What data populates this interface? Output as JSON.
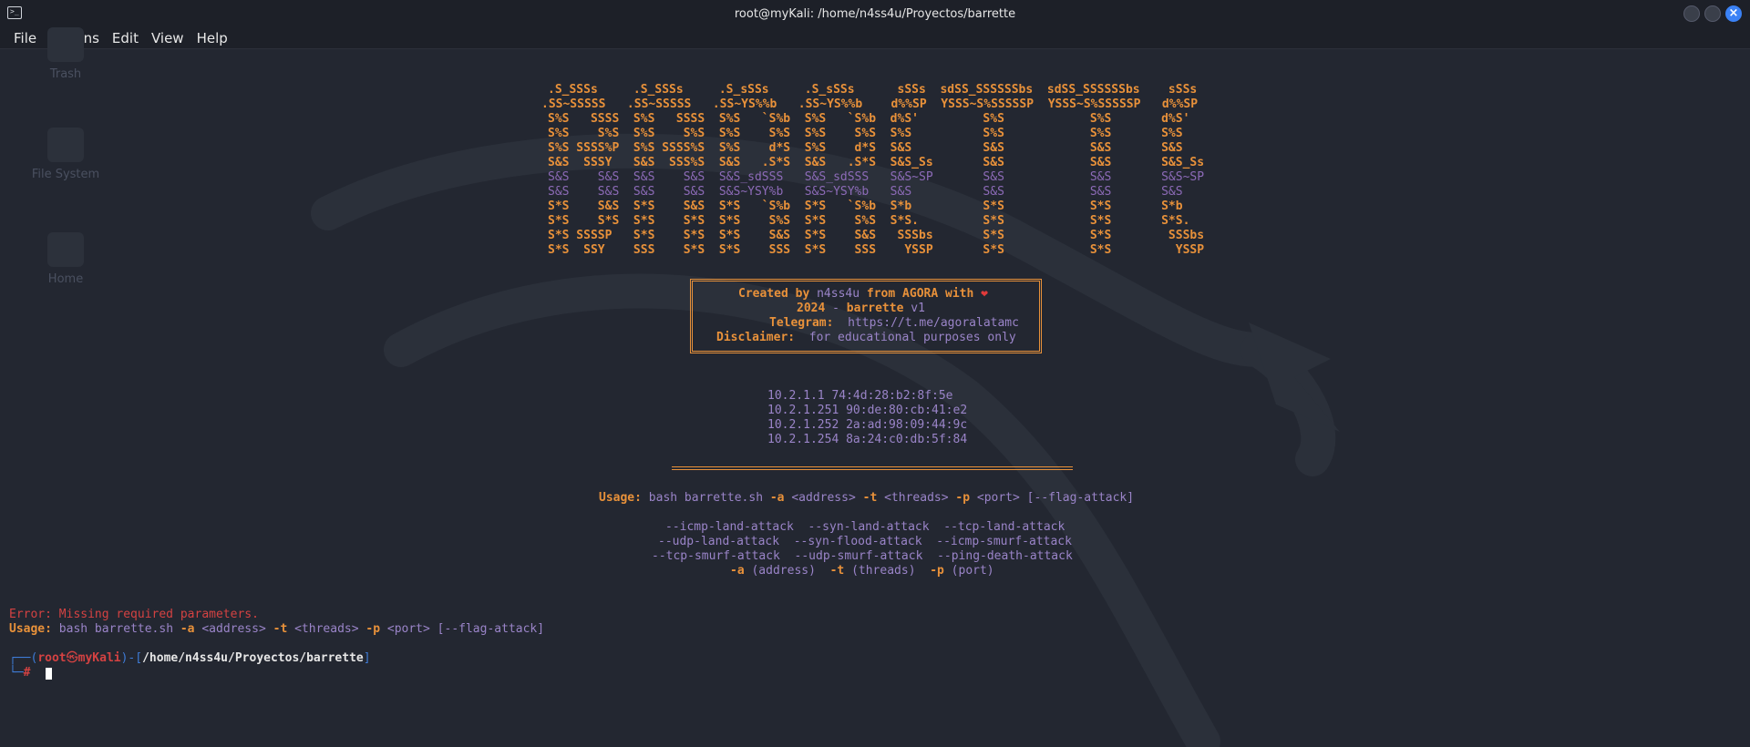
{
  "window": {
    "title": "root@myKali: /home/n4ss4u/Proyectos/barrette",
    "close_glyph": "×"
  },
  "menu": {
    "file": "File",
    "actions": "Actions",
    "edit": "Edit",
    "view": "View",
    "help": "Help"
  },
  "desktop": {
    "trash": "Trash",
    "filesystem": "File System",
    "home": "Home"
  },
  "banner": {
    "lines": [
      ".S_SSSs     .S_SSSs     .S_sSSs     .S_sSSs      sSSs  sdSS_SSSSSSbs  sdSS_SSSSSSbs    sSSs",
      ".SS~SSSSS   .SS~SSSSS   .SS~YS%%b   .SS~YS%%b    d%%SP  YSSS~S%SSSSSP  YSSS~S%SSSSSP   d%%SP",
      "S%S   SSSS  S%S   SSSS  S%S   `S%b  S%S   `S%b  d%S'         S%S            S%S       d%S'",
      "S%S    S%S  S%S    S%S  S%S    S%S  S%S    S%S  S%S          S%S            S%S       S%S",
      "S%S SSSS%P  S%S SSSS%S  S%S    d*S  S%S    d*S  S&S          S&S            S&S       S&S",
      "S&S  SSSY   S&S  SSS%S  S&S   .S*S  S&S   .S*S  S&S_Ss       S&S            S&S       S&S_Ss",
      "S&S    S&S  S&S    S&S  S&S_sdSSS   S&S_sdSSS   S&S~SP       S&S            S&S       S&S~SP",
      "S&S    S&S  S&S    S&S  S&S~YSY%b   S&S~YSY%b   S&S          S&S            S&S       S&S",
      "S*S    S&S  S*S    S&S  S*S   `S%b  S*S   `S%b  S*b          S*S            S*S       S*b",
      "S*S    S*S  S*S    S*S  S*S    S%S  S*S    S%S  S*S.         S*S            S*S       S*S.",
      "S*S SSSSP   S*S    S*S  S*S    S&S  S*S    S&S   SSSbs       S*S            S*S        SSSbs",
      "S*S  SSY    SSS    S*S  S*S    SSS  S*S    SSS    YSSP       S*S            S*S         YSSP"
    ]
  },
  "info": {
    "created_label": "Created by",
    "author": "n4ss4u",
    "from_label": "from AGORA with",
    "heart": "❤",
    "year_label": "2024",
    "year_sep": " - ",
    "tool_name": "barrette",
    "version": "v1",
    "telegram_label": "Telegram:",
    "telegram_value": "https://t.me/agoralatamc",
    "disclaimer_label": "Disclaimer:",
    "disclaimer_value": "for educational purposes only"
  },
  "hosts": [
    "10.2.1.1 74:4d:28:b2:8f:5e",
    "10.2.1.251 90:de:80:cb:41:e2",
    "10.2.1.252 2a:ad:98:09:44:9c",
    "10.2.1.254 8a:24:c0:db:5f:84"
  ],
  "usage": {
    "label": "Usage:",
    "cmd": "bash barrette.sh",
    "flag_a": "-a",
    "arg_a": "<address>",
    "flag_t": "-t",
    "arg_t": "<threads>",
    "flag_p": "-p",
    "arg_p": "<port>",
    "arg_flag": "[--flag-attack]"
  },
  "attacks": {
    "row1": "--icmp-land-attack  --syn-land-attack  --tcp-land-attack",
    "row2": "--udp-land-attack  --syn-flood-attack  --icmp-smurf-attack",
    "row3": "--tcp-smurf-attack  --udp-smurf-attack  --ping-death-attack",
    "flag_a": "-a",
    "desc_a": "(address)",
    "flag_t": "-t",
    "desc_t": "(threads)",
    "flag_p": "-p",
    "desc_p": "(port)"
  },
  "error": {
    "message": "Error: Missing required parameters."
  },
  "prompt": {
    "corner_top": "┌──(",
    "user": "root",
    "at": "㉿",
    "host": "myKali",
    "close_paren": ")-[",
    "path": "/home/n4ss4u/Proyectos/barrette",
    "close_bracket": "]",
    "corner_bottom": "└─",
    "symbol": "#"
  }
}
